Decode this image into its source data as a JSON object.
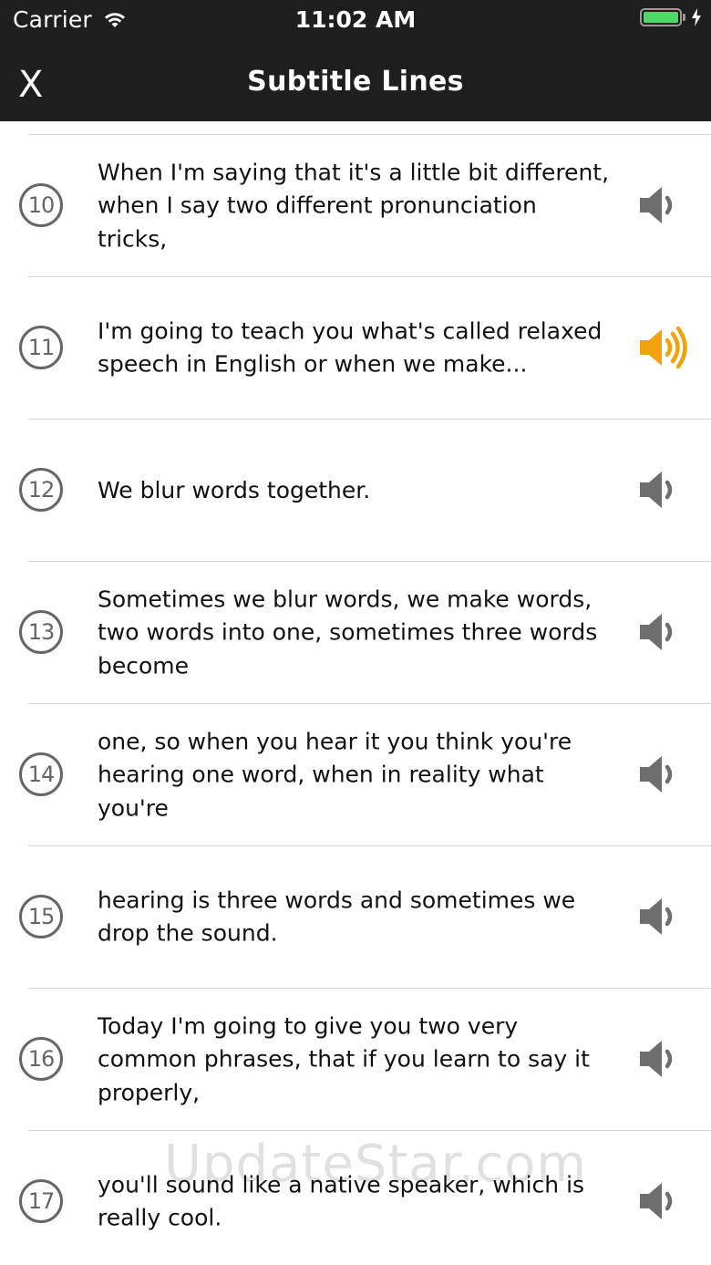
{
  "status_bar": {
    "carrier": "Carrier",
    "time": "11:02 AM",
    "battery_color": "#4cd964"
  },
  "nav": {
    "close_label": "X",
    "title": "Subtitle Lines"
  },
  "rows": [
    {
      "num": "10",
      "text": "When I'm saying that it's a little bit different, when I say two different pronunciation tricks,",
      "playing": false
    },
    {
      "num": "11",
      "text": "I'm going to teach you what's called relaxed speech in English or when we make...",
      "playing": true
    },
    {
      "num": "12",
      "text": "We blur words together.",
      "playing": false
    },
    {
      "num": "13",
      "text": "Sometimes we blur words, we make words, two words into one, sometimes three words become",
      "playing": false
    },
    {
      "num": "14",
      "text": "one, so when you hear it you think you're hearing one word, when in reality what you're",
      "playing": false
    },
    {
      "num": "15",
      "text": "hearing is three words and sometimes we drop the sound.",
      "playing": false
    },
    {
      "num": "16",
      "text": "Today I'm going to give you two very common phrases, that if you learn to say it properly,",
      "playing": false
    },
    {
      "num": "17",
      "text": "you'll sound like a native speaker, which is really cool.",
      "playing": false
    }
  ],
  "colors": {
    "speaker_idle": "#6e6e6e",
    "speaker_active": "#f0a30a"
  },
  "watermark": "UpdateStar.com"
}
